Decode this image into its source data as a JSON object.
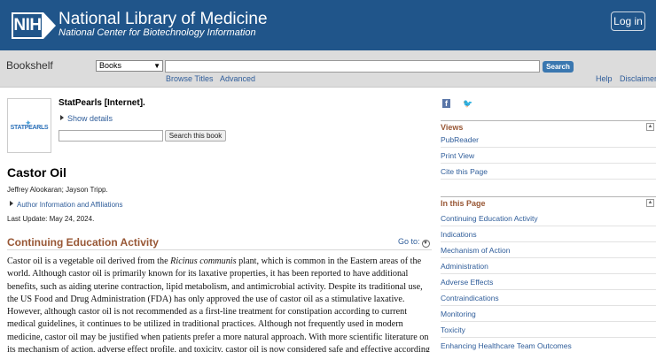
{
  "header": {
    "logo_text": "NIH",
    "title": "National Library of Medicine",
    "subtitle": "National Center for Biotechnology Information",
    "login_label": "Log in",
    "bg_color": "#20558a"
  },
  "bookshelf_bar": {
    "bookshelf_label": "Bookshelf",
    "db_selected": "Books",
    "search_value": "",
    "search_button": "Search",
    "links": {
      "browse_titles": "Browse Titles",
      "advanced": "Advanced",
      "help": "Help",
      "disclaimer": "Disclaimer"
    }
  },
  "book": {
    "cover_text": "STATPEARLS",
    "title": "StatPearls [Internet].",
    "show_details": "Show details",
    "search_button": "Search this book"
  },
  "article": {
    "title": "Castor Oil",
    "authors": "Jeffrey Alookaran; Jayson Tripp.",
    "author_info": "Author Information and Affiliations",
    "last_update": "Last Update: May 24, 2024.",
    "section_title": "Continuing Education Activity",
    "goto": "Go to:",
    "paragraph_lines": [
      [
        "Castor oil is a vegetable oil derived from the ",
        "Ricinus communis",
        " plant, which is common in the Eastern areas of the"
      ],
      [
        "world. Although castor oil is primarily known for its laxative properties, it has been reported to have additional"
      ],
      [
        "benefits, such as aiding uterine contraction, lipid metabolism, and antimicrobial activity. Despite its traditional use,"
      ],
      [
        "the US Food and Drug Administration (FDA) has only approved the use of castor oil as a stimulative laxative."
      ],
      [
        "However, although castor oil is not recommended as a first-line treatment for constipation according to current"
      ],
      [
        "medical guidelines, it continues to be utilized in traditional practices. Although not frequently used in modern"
      ],
      [
        "medicine, castor oil may be justified when patients prefer a more natural approach. With more scientific literature on"
      ],
      [
        "its mechanism of action, adverse effect profile, and toxicity, castor oil is now considered safe and effective according"
      ]
    ]
  },
  "sidebar": {
    "share_icons": [
      "facebook-icon",
      "twitter-icon"
    ],
    "views_heading": "Views",
    "views": [
      "PubReader",
      "Print View",
      "Cite this Page"
    ],
    "in_this_page_heading": "In this Page",
    "in_this_page": [
      "Continuing Education Activity",
      "Indications",
      "Mechanism of Action",
      "Administration",
      "Adverse Effects",
      "Contraindications",
      "Monitoring",
      "Toxicity",
      "Enhancing Healthcare Team Outcomes"
    ],
    "accent_color": "#985735"
  }
}
